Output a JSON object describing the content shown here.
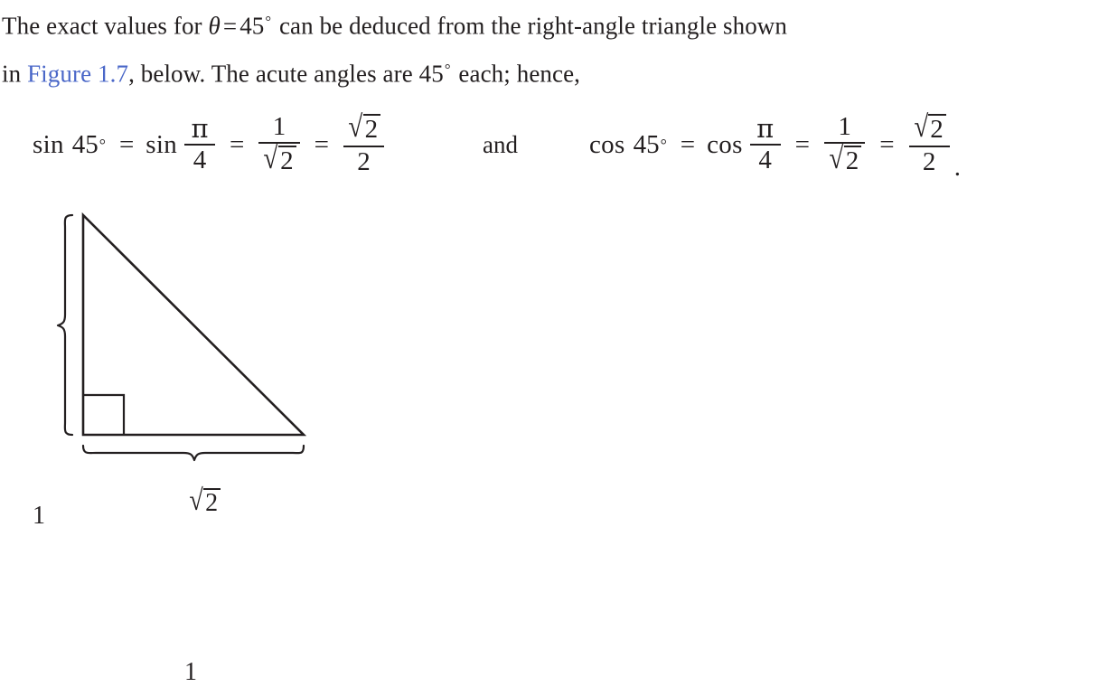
{
  "colors": {
    "text": "#231f20",
    "link": "#4a67c8",
    "stroke": "#231f20",
    "background": "#ffffff"
  },
  "prose": {
    "line1_part1": "The exact values for ",
    "theta_symbol": "θ",
    "equals": "=",
    "angle_value": "45",
    "degree_symbol": "°",
    "line1_part2": " can be deduced from the right-angle triangle shown",
    "line2_part1": "in ",
    "figure_link": "Figure 1.7",
    "line2_part2": ", below. The acute angles are ",
    "line2_angle": "45",
    "line2_part3": " each; hence,"
  },
  "equation": {
    "left": {
      "function_name": "sin",
      "degree_argument": "45",
      "degree_symbol": "°",
      "relation1": "=",
      "function_name_2": "sin",
      "radian_numerator": "π",
      "radian_denominator": "4",
      "relation2": "=",
      "frac2_numerator": "1",
      "frac2_denominator_radicand": "2",
      "radical_symbol": "√",
      "relation3": "=",
      "frac3_numerator_radicand": "2",
      "frac3_denominator": "2"
    },
    "conjunction": "and",
    "right": {
      "function_name": "cos",
      "degree_argument": "45",
      "degree_symbol": "°",
      "relation1": "=",
      "function_name_2": "cos",
      "radian_numerator": "π",
      "radian_denominator": "4",
      "relation2": "=",
      "frac2_numerator": "1",
      "frac2_denominator_radicand": "2",
      "radical_symbol": "√",
      "relation3": "=",
      "frac3_numerator_radicand": "2",
      "frac3_denominator": "2",
      "terminal_punctuation": "."
    }
  },
  "figure": {
    "caption_reference": "Figure 1.7",
    "vertical_side_label": "1",
    "horizontal_side_label": "1",
    "hypotenuse_radicand": "2",
    "hypotenuse_radical_symbol": "√",
    "right_angle_marker": "right-angle-square",
    "triangle": {
      "apex": [
        92,
        22
      ],
      "right_angle_vertex": [
        92,
        265
      ],
      "base_vertex": [
        336,
        265
      ]
    }
  }
}
